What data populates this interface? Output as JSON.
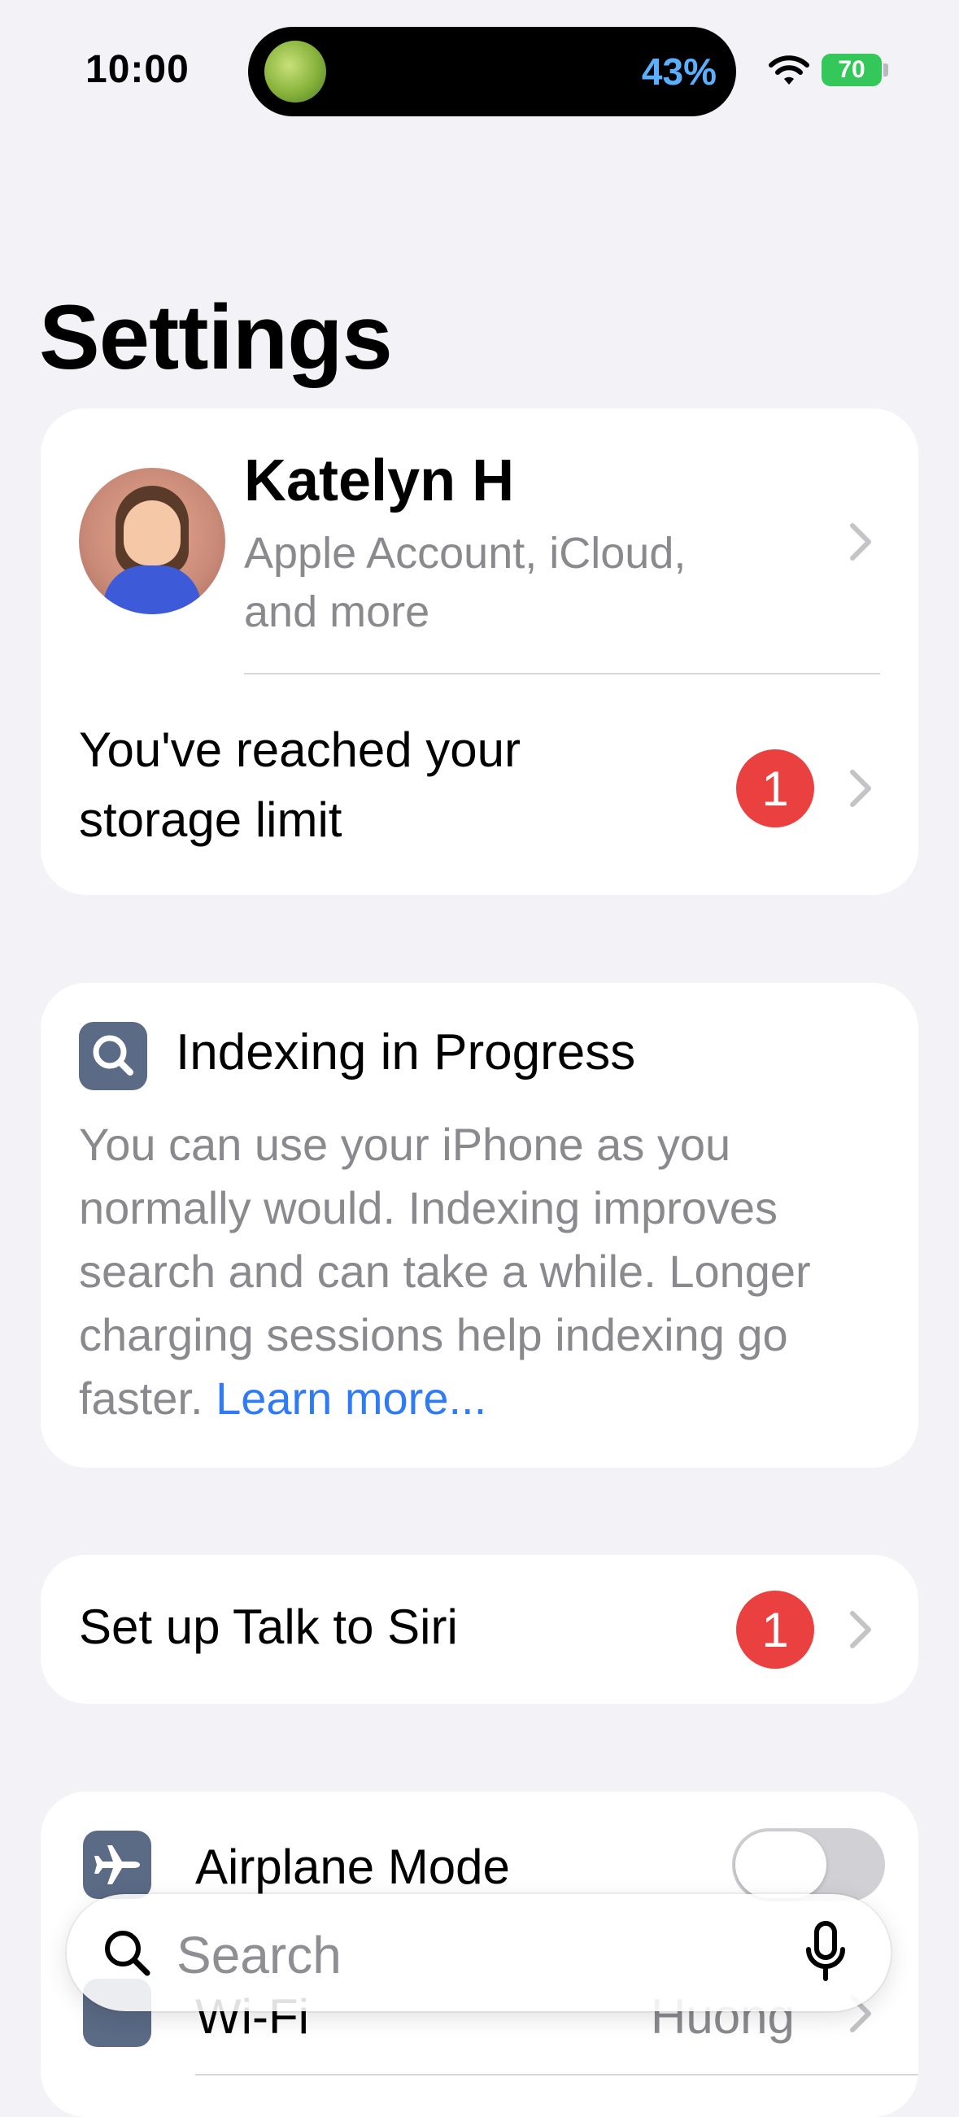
{
  "status_bar": {
    "time": "10:00",
    "activity_percent": "43%",
    "battery_level": "70",
    "icons": [
      "app-activity-icon",
      "wifi-icon",
      "battery-charging-icon"
    ]
  },
  "page": {
    "title": "Settings"
  },
  "account": {
    "name": "Katelyn H",
    "subtitle": "Apple Account, iCloud, and more",
    "storage_alert": "You've reached your storage limit",
    "storage_badge": "1"
  },
  "indexing": {
    "title": "Indexing in Progress",
    "body": "You can use your iPhone as you normally would. Indexing improves search and can take a while. Longer charging sessions help indexing go faster.",
    "link": "Learn more..."
  },
  "siri": {
    "label": "Set up Talk to Siri",
    "badge": "1"
  },
  "settings_list": [
    {
      "label": "Airplane Mode",
      "icon": "airplane-icon",
      "toggle_on": false
    },
    {
      "label": "Wi-Fi",
      "icon": "wifi-icon",
      "value": "Huong"
    }
  ],
  "search": {
    "placeholder": "Search",
    "icons": [
      "search-icon",
      "microphone-icon"
    ]
  },
  "colors": {
    "background": "#f2f2f7",
    "badge": "#eb4040",
    "link": "#2f7bf5",
    "battery": "#34c759",
    "activity_text": "#5ab0ff",
    "icon_tile": "#5b6a85"
  }
}
